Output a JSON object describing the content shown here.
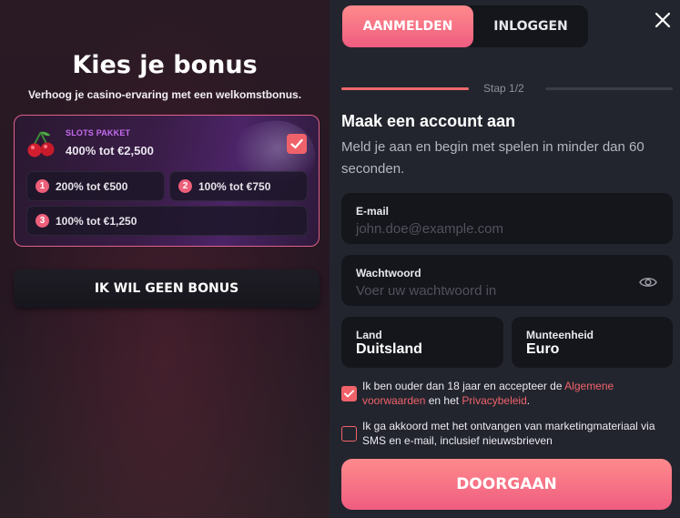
{
  "bonus": {
    "title": "Kies je bonus",
    "subtitle": "Verhoog je casino-ervaring met een welkomstbonus.",
    "package": {
      "tag": "SLOTS PAKKET",
      "main": "400% tot €2,500",
      "selected": true
    },
    "options": [
      {
        "num": "1",
        "label": "200% tot €500"
      },
      {
        "num": "2",
        "label": "100% tot €750"
      },
      {
        "num": "3",
        "label": "100% tot €1,250"
      }
    ],
    "no_bonus_label": "IK WIL GEEN BONUS"
  },
  "auth": {
    "tabs": [
      {
        "label": "AANMELDEN",
        "active": true
      },
      {
        "label": "INLOGGEN",
        "active": false
      }
    ],
    "step_label": "Stap 1/2",
    "title": "Maak een account aan",
    "subtitle": "Meld je aan en begin met spelen in minder dan 60 seconden.",
    "email": {
      "label": "E-mail",
      "placeholder": "john.doe@example.com"
    },
    "password": {
      "label": "Wachtwoord",
      "placeholder": "Voer uw wachtwoord in"
    },
    "country": {
      "label": "Land",
      "value": "Duitsland"
    },
    "currency": {
      "label": "Munteenheid",
      "value": "Euro"
    },
    "terms": {
      "checked": true,
      "text_before": "Ik ben ouder dan 18 jaar en accepteer de ",
      "link_terms": "Algemene voorwaarden",
      "text_mid": " en het ",
      "link_privacy": "Privacybeleid",
      "text_after": "."
    },
    "marketing": {
      "checked": false,
      "text": "Ik ga akkoord met het ontvangen van marketingmateriaal via SMS en e-mail, inclusief nieuwsbrieven"
    },
    "submit_label": "DOORGAAN"
  },
  "colors": {
    "accent": "#f0626a",
    "accent_gradient_top": "#ff8a8c",
    "accent_gradient_bottom": "#ef5d80",
    "field_bg": "#15161c",
    "panel_bg": "#23252e",
    "package_tag": "#c56cf0"
  },
  "icons": {
    "close": "close-icon",
    "eye": "eye-icon",
    "check": "check-icon",
    "cherry": "cherry-icon"
  }
}
